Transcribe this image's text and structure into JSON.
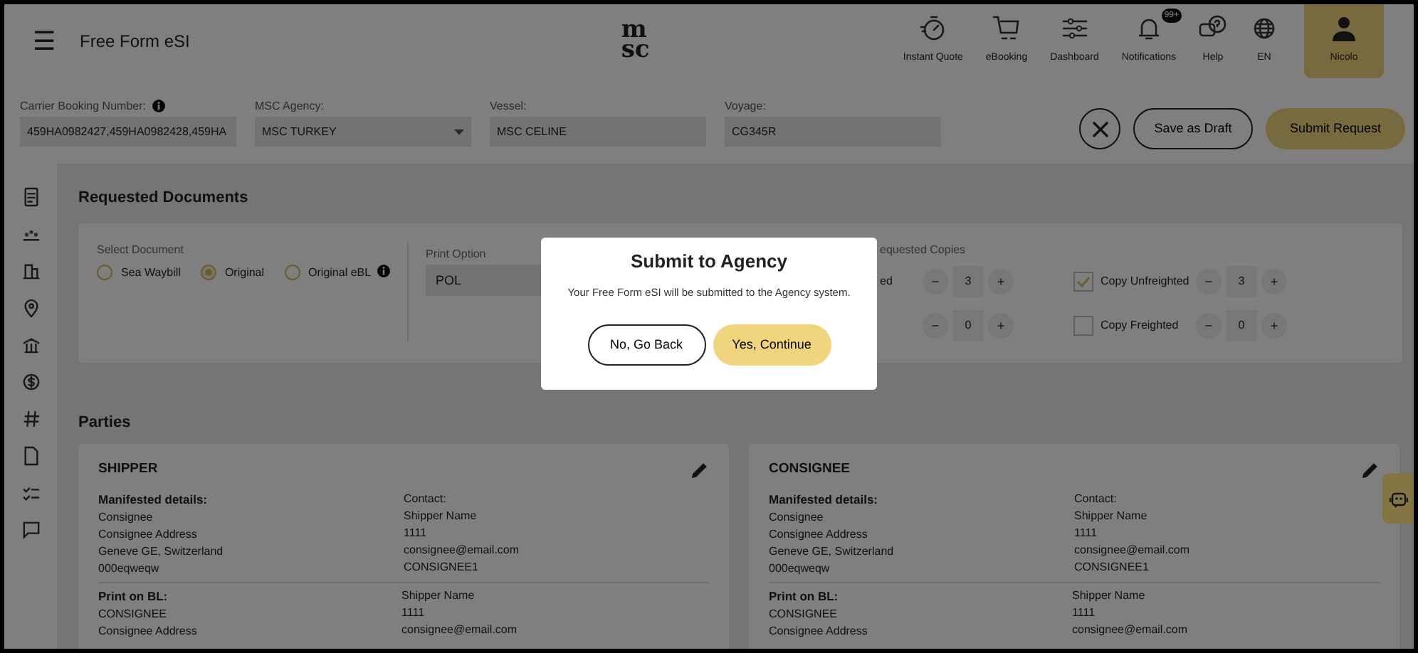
{
  "header": {
    "menu_icon": "☰",
    "title": "Free Form eSI",
    "logo_lines": [
      "m",
      "sc"
    ],
    "nav": [
      {
        "kind": "stopwatch",
        "label": "Instant Quote"
      },
      {
        "kind": "cart",
        "label": "eBooking"
      },
      {
        "kind": "sliders",
        "label": "Dashboard"
      },
      {
        "kind": "bell",
        "label": "Notifications",
        "badge": "99+"
      },
      {
        "kind": "help",
        "label": "Help"
      },
      {
        "kind": "globe",
        "label": "EN"
      },
      {
        "kind": "user",
        "label": "Nicolo",
        "selected": true
      }
    ]
  },
  "booking_bar": {
    "fields": [
      {
        "kind": "text",
        "label": "Carrier Booking Number:",
        "info": true,
        "value": "459HA0982427,459HA0982428,459HA"
      },
      {
        "kind": "select",
        "label": "MSC Agency:",
        "value": "MSC TURKEY"
      },
      {
        "kind": "text",
        "label": "Vessel:",
        "value": "MSC CELINE"
      },
      {
        "kind": "text",
        "label": "Voyage:",
        "value": "CG345R"
      }
    ],
    "save_draft": "Save as Draft",
    "submit": "Submit Request"
  },
  "requested_documents": {
    "title": "Requested Documents",
    "select_document": {
      "label": "Select Document",
      "options": [
        {
          "label": "Sea Waybill",
          "selected": false
        },
        {
          "label": "Original",
          "selected": true
        },
        {
          "label": "Original eBL",
          "selected": false,
          "info": true
        }
      ]
    },
    "print_option": {
      "label": "Print Option",
      "value": "POL"
    },
    "copies": {
      "label": "equested Copies",
      "items": [
        {
          "label": "ed",
          "minus": "−",
          "value": "3",
          "plus": "+"
        },
        {
          "minus": "−",
          "value": "0",
          "plus": "+"
        },
        {
          "label": "Copy Unfreighted",
          "checked": true,
          "minus": "−",
          "value": "3",
          "plus": "+"
        },
        {
          "label": "Copy Freighted",
          "checked": false,
          "minus": "−",
          "value": "0",
          "plus": "+"
        }
      ]
    }
  },
  "parties": {
    "title": "Parties",
    "cards": [
      {
        "title": "SHIPPER",
        "manifested_label": "Manifested details:",
        "manifested": [
          "Consignee",
          "Consignee Address",
          "Geneve GE, Switzerland",
          "000eqweqw"
        ],
        "contact_label": "Contact:",
        "contact": [
          "Shipper Name",
          "1111",
          "consignee@email.com",
          "CONSIGNEE1"
        ],
        "print_label": "Print on BL:",
        "print": [
          "CONSIGNEE",
          "Consignee Address"
        ],
        "print_contact": [
          "Shipper Name",
          "1111",
          "consignee@email.com"
        ]
      },
      {
        "title": "CONSIGNEE",
        "manifested_label": "Manifested details:",
        "manifested": [
          "Consignee",
          "Consignee Address",
          "Geneve GE, Switzerland",
          "000eqweqw"
        ],
        "contact_label": "Contact:",
        "contact": [
          "Shipper Name",
          "1111",
          "consignee@email.com",
          "CONSIGNEE1"
        ],
        "print_label": "Print on BL:",
        "print": [
          "CONSIGNEE",
          "Consignee Address"
        ],
        "print_contact": [
          "Shipper Name",
          "1111",
          "consignee@email.com"
        ]
      }
    ]
  },
  "dialog": {
    "title": "Submit to Agency",
    "message": "Your Free Form eSI will be submitted to the Agency system.",
    "cancel": "No, Go Back",
    "confirm": "Yes, Continue"
  }
}
